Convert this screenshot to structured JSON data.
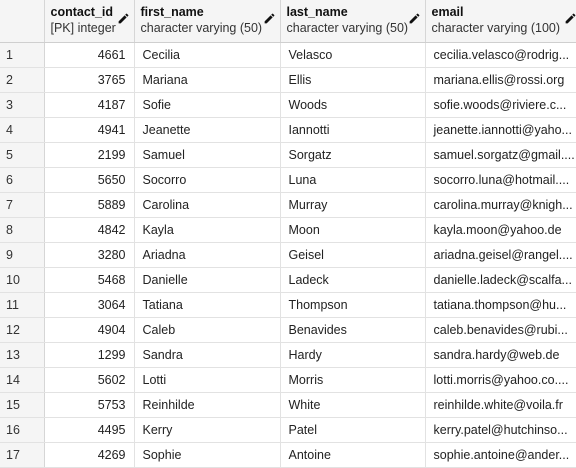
{
  "columns": [
    {
      "name": "contact_id",
      "type": "[PK] integer"
    },
    {
      "name": "first_name",
      "type": "character varying (50)"
    },
    {
      "name": "last_name",
      "type": "character varying (50)"
    },
    {
      "name": "email",
      "type": "character varying (100)"
    }
  ],
  "icons": {
    "edit": "pencil-icon"
  },
  "rows": [
    {
      "n": "1",
      "id": "4661",
      "first": "Cecilia",
      "last": "Velasco",
      "email": "cecilia.velasco@rodrig..."
    },
    {
      "n": "2",
      "id": "3765",
      "first": "Mariana",
      "last": "Ellis",
      "email": "mariana.ellis@rossi.org"
    },
    {
      "n": "3",
      "id": "4187",
      "first": "Sofie",
      "last": "Woods",
      "email": "sofie.woods@riviere.c..."
    },
    {
      "n": "4",
      "id": "4941",
      "first": "Jeanette",
      "last": "Iannotti",
      "email": "jeanette.iannotti@yaho..."
    },
    {
      "n": "5",
      "id": "2199",
      "first": "Samuel",
      "last": "Sorgatz",
      "email": "samuel.sorgatz@gmail...."
    },
    {
      "n": "6",
      "id": "5650",
      "first": "Socorro",
      "last": "Luna",
      "email": "socorro.luna@hotmail...."
    },
    {
      "n": "7",
      "id": "5889",
      "first": "Carolina",
      "last": "Murray",
      "email": "carolina.murray@knigh..."
    },
    {
      "n": "8",
      "id": "4842",
      "first": "Kayla",
      "last": "Moon",
      "email": "kayla.moon@yahoo.de"
    },
    {
      "n": "9",
      "id": "3280",
      "first": "Ariadna",
      "last": "Geisel",
      "email": "ariadna.geisel@rangel...."
    },
    {
      "n": "10",
      "id": "5468",
      "first": "Danielle",
      "last": "Ladeck",
      "email": "danielle.ladeck@scalfa..."
    },
    {
      "n": "11",
      "id": "3064",
      "first": "Tatiana",
      "last": "Thompson",
      "email": "tatiana.thompson@hu..."
    },
    {
      "n": "12",
      "id": "4904",
      "first": "Caleb",
      "last": "Benavides",
      "email": "caleb.benavides@rubi..."
    },
    {
      "n": "13",
      "id": "1299",
      "first": "Sandra",
      "last": "Hardy",
      "email": "sandra.hardy@web.de"
    },
    {
      "n": "14",
      "id": "5602",
      "first": "Lotti",
      "last": "Morris",
      "email": "lotti.morris@yahoo.co...."
    },
    {
      "n": "15",
      "id": "5753",
      "first": "Reinhilde",
      "last": "White",
      "email": "reinhilde.white@voila.fr"
    },
    {
      "n": "16",
      "id": "4495",
      "first": "Kerry",
      "last": "Patel",
      "email": "kerry.patel@hutchinso..."
    },
    {
      "n": "17",
      "id": "4269",
      "first": "Sophie",
      "last": "Antoine",
      "email": "sophie.antoine@ander..."
    }
  ]
}
